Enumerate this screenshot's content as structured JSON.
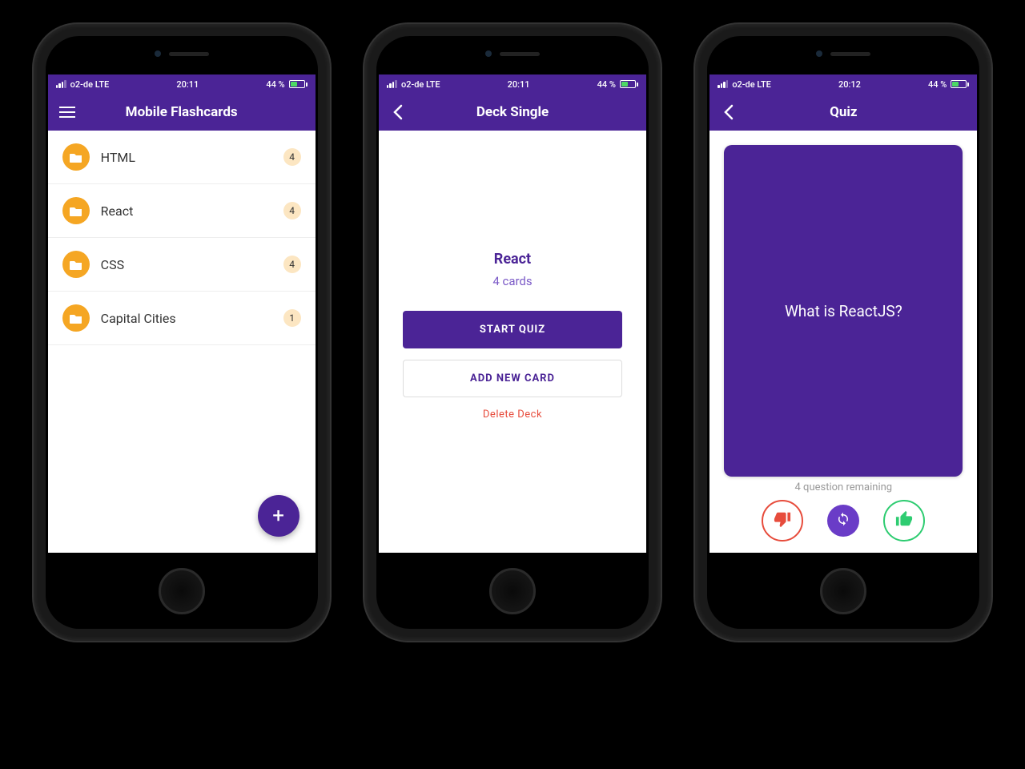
{
  "status": {
    "carrier": "o2-de LTE",
    "battery": "44 %"
  },
  "phone1": {
    "time": "20:11",
    "title": "Mobile Flashcards",
    "decks": [
      {
        "name": "HTML",
        "count": "4"
      },
      {
        "name": "React",
        "count": "4"
      },
      {
        "name": "CSS",
        "count": "4"
      },
      {
        "name": "Capital Cities",
        "count": "1"
      }
    ]
  },
  "phone2": {
    "time": "20:11",
    "title": "Deck Single",
    "deck_title": "React",
    "deck_sub": "4 cards",
    "start_quiz": "START QUIZ",
    "add_card": "ADD NEW CARD",
    "delete": "Delete Deck"
  },
  "phone3": {
    "time": "20:12",
    "title": "Quiz",
    "question": "What is ReactJS?",
    "remaining": "4 question remaining"
  }
}
